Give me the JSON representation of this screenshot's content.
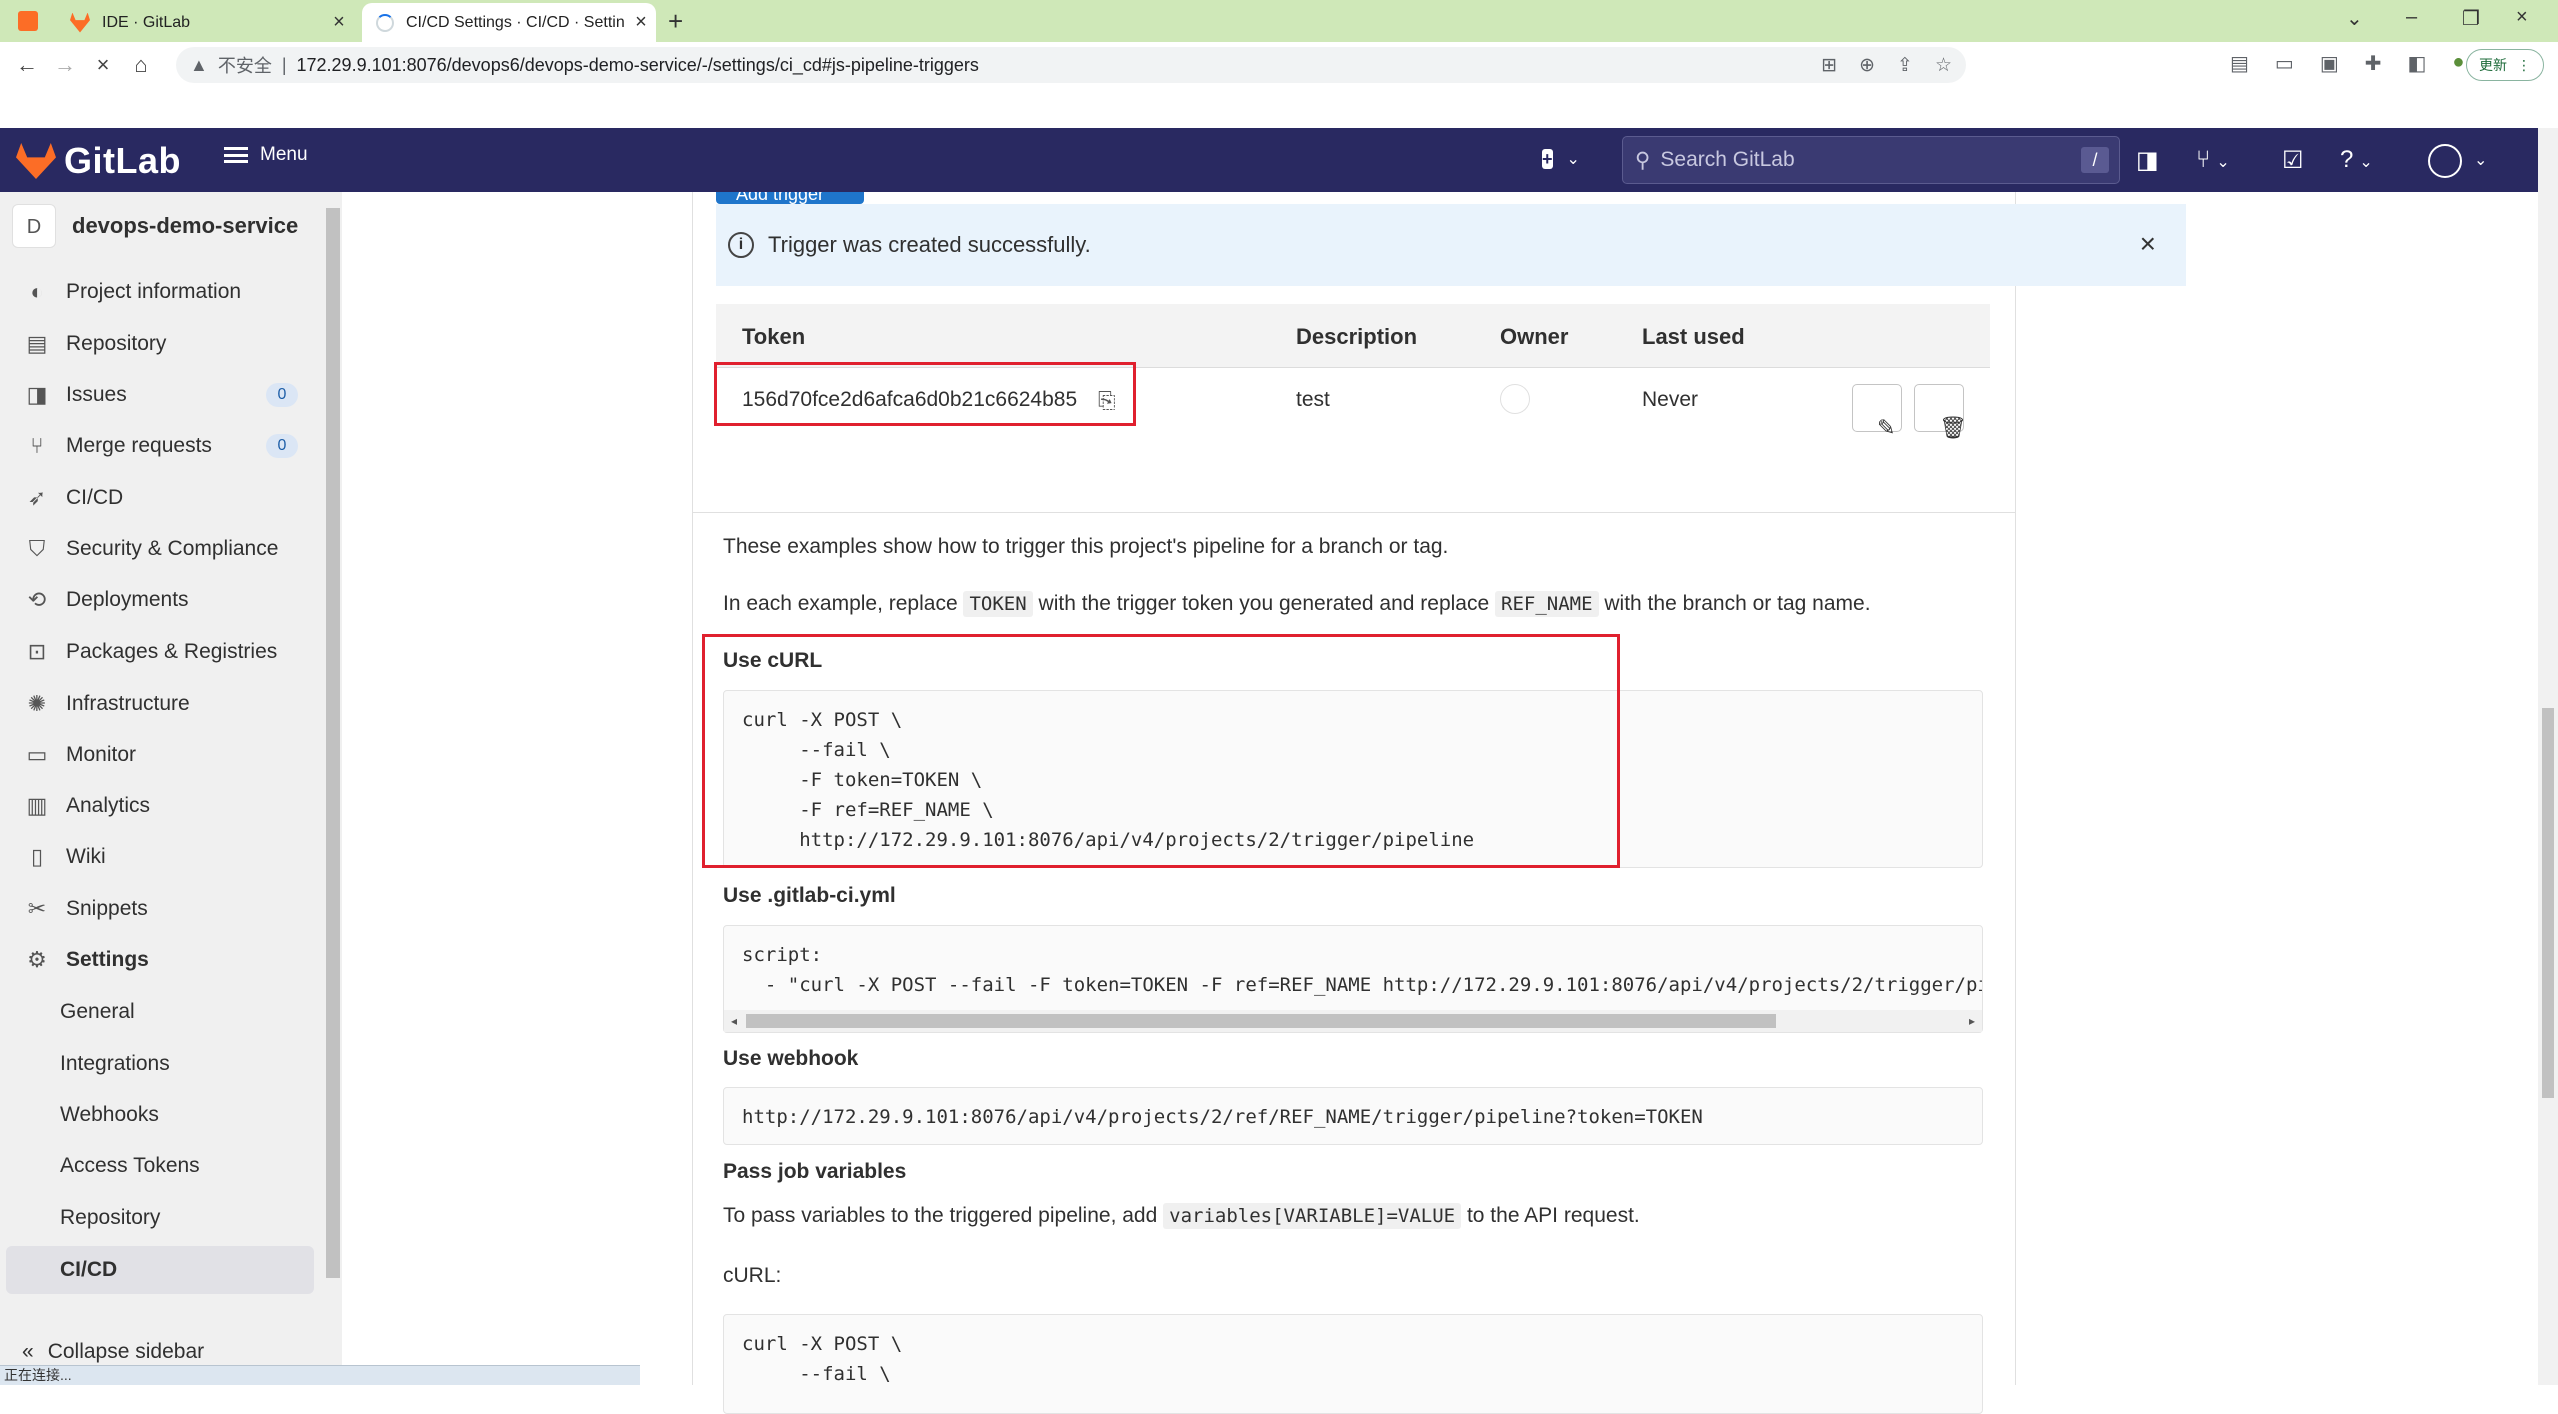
{
  "browser": {
    "tabs": [
      {
        "title": "IDE · GitLab",
        "active": false
      },
      {
        "title": "CI/CD Settings · CI/CD · Settin",
        "active": true
      }
    ],
    "security_label": "不安全",
    "url": "172.29.9.101:8076/devops6/devops-demo-service/-/settings/ci_cd#js-pipeline-triggers",
    "update_label": "更新",
    "status_text": "正在连接..."
  },
  "header": {
    "brand": "GitLab",
    "menu_label": "Menu",
    "search_placeholder": "Search GitLab",
    "search_shortcut": "/"
  },
  "sidebar": {
    "project_initial": "D",
    "project_name": "devops-demo-service",
    "items": [
      {
        "label": "Project information",
        "icon": "info-icon"
      },
      {
        "label": "Repository",
        "icon": "document-icon"
      },
      {
        "label": "Issues",
        "icon": "issues-icon",
        "badge": "0"
      },
      {
        "label": "Merge requests",
        "icon": "merge-request-icon",
        "badge": "0"
      },
      {
        "label": "CI/CD",
        "icon": "rocket-icon"
      },
      {
        "label": "Security & Compliance",
        "icon": "shield-icon"
      },
      {
        "label": "Deployments",
        "icon": "deployments-icon"
      },
      {
        "label": "Packages & Registries",
        "icon": "package-icon"
      },
      {
        "label": "Infrastructure",
        "icon": "cloud-gear-icon"
      },
      {
        "label": "Monitor",
        "icon": "monitor-icon"
      },
      {
        "label": "Analytics",
        "icon": "chart-icon"
      },
      {
        "label": "Wiki",
        "icon": "book-icon"
      },
      {
        "label": "Snippets",
        "icon": "scissors-icon"
      },
      {
        "label": "Settings",
        "icon": "gear-icon"
      }
    ],
    "settings_sub": [
      "General",
      "Integrations",
      "Webhooks",
      "Access Tokens",
      "Repository",
      "CI/CD"
    ],
    "collapse_label": "Collapse sidebar"
  },
  "main": {
    "add_trigger_label": "Add trigger",
    "alert_text": "Trigger was created successfully.",
    "table": {
      "headers": [
        "Token",
        "Description",
        "Owner",
        "Last used"
      ],
      "row": {
        "token": "156d70fce2d6afca6d0b21c6624b85",
        "description": "test",
        "last_used": "Never"
      }
    },
    "intro_1": "These examples show how to trigger this project's pipeline for a branch or tag.",
    "intro_2": {
      "pre": "In each example, replace",
      "code1": "TOKEN",
      "mid": "with the trigger token you generated and replace",
      "code2": "REF_NAME",
      "post": "with the branch or tag name."
    },
    "curl_heading": "Use cURL",
    "curl_code": "curl -X POST \\\n     --fail \\\n     -F token=TOKEN \\\n     -F ref=REF_NAME \\\n     http://172.29.9.101:8076/api/v4/projects/2/trigger/pipeline",
    "yml_heading": "Use .gitlab-ci.yml",
    "yml_code": "script:\n  - \"curl -X POST --fail -F token=TOKEN -F ref=REF_NAME http://172.29.9.101:8076/api/v4/projects/2/trigger/pipeline\"",
    "webhook_heading": "Use webhook",
    "webhook_code": "http://172.29.9.101:8076/api/v4/projects/2/ref/REF_NAME/trigger/pipeline?token=TOKEN",
    "vars_heading": "Pass job variables",
    "vars_text": {
      "pre": "To pass variables to the triggered pipeline, add",
      "code": "variables[VARIABLE]=VALUE",
      "post": "to the API request."
    },
    "curl_label": "cURL:",
    "vars_curl_code": "curl -X POST \\\n     --fail \\"
  }
}
